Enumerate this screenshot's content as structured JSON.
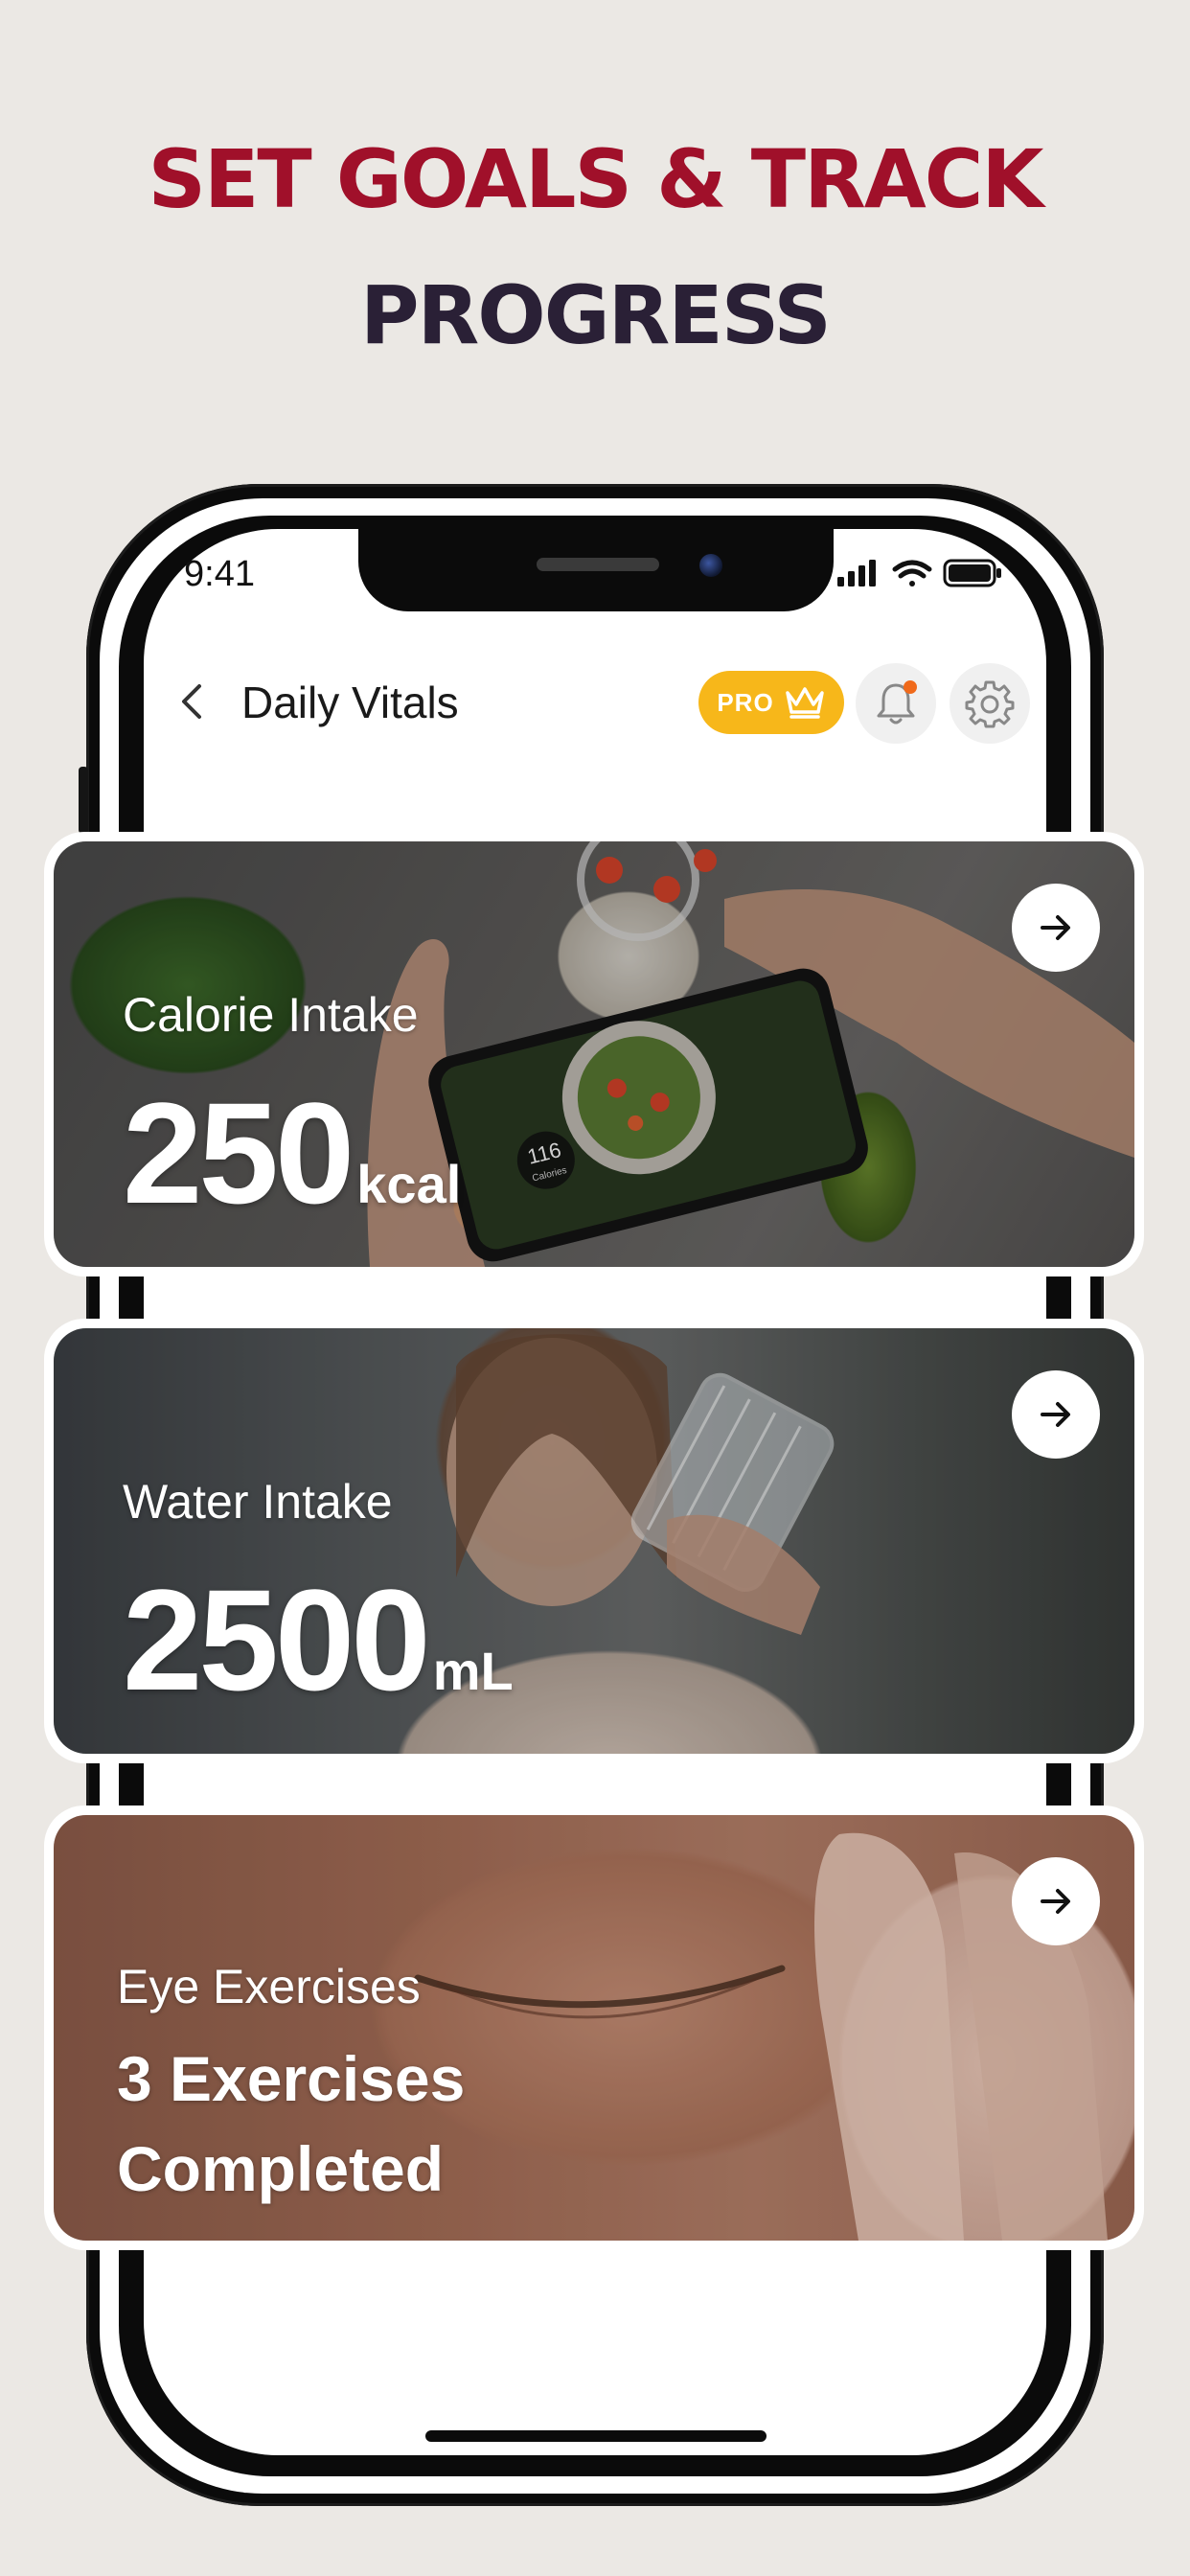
{
  "headline": {
    "line1": "SET GOALS & TRACK",
    "line2": "PROGRESS"
  },
  "status_bar": {
    "time": "9:41"
  },
  "header": {
    "title": "Daily Vitals",
    "pro_label": "PRO"
  },
  "cards": [
    {
      "label": "Calorie Intake",
      "value": "250",
      "unit": "kcal",
      "phone_reading": "116",
      "phone_reading_unit": "Calories"
    },
    {
      "label": "Water Intake",
      "value": "2500",
      "unit": "mL"
    },
    {
      "label": "Eye Exercises",
      "line1": "3 Exercises",
      "line2": "Completed"
    }
  ],
  "icons": [
    "back-chevron-icon",
    "crown-icon",
    "bell-icon",
    "gear-icon",
    "arrow-right-icon",
    "signal-icon",
    "wifi-icon",
    "battery-icon"
  ],
  "colors": {
    "headline_red": "#a0102a",
    "headline_dark": "#2a2036",
    "pro_badge": "#f7b71a",
    "notification_dot": "#f06a1b",
    "background": "#ebe8e4"
  }
}
